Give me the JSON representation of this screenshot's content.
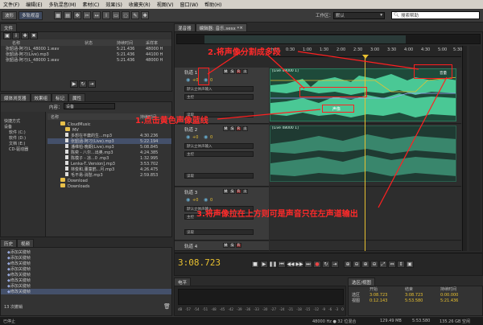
{
  "menu": [
    "文件(F)",
    "编辑(E)",
    "多轨混音(M)",
    "素材(C)",
    "效果(S)",
    "收藏夹(R)",
    "视图(V)",
    "窗口(W)",
    "帮助(H)"
  ],
  "toolbar": {
    "waveform_label": "波形",
    "multitrack_label": "多轨视音",
    "workspace_label": "工作区：",
    "workspace_value": "默认",
    "search_placeholder": "搜索帮助"
  },
  "files_panel": {
    "tab": "文件",
    "columns": [
      "名称",
      "状态",
      "持续时间",
      "采样率"
    ],
    "rows": [
      {
        "name": "张韶涵-阿刁(L_48000 1.wav",
        "duration": "5:21.436",
        "rate": "48000 H"
      },
      {
        "name": "张韶涵-阿刁(Live).mp3",
        "duration": "5:21.436",
        "rate": "44100 H"
      },
      {
        "name": "张韶涵-阿刁(L_48000 1.wav",
        "duration": "5:21.436",
        "rate": "48000 H"
      }
    ]
  },
  "media_panel": {
    "tabs": [
      "媒体浏览器",
      "效果组",
      "标记",
      "属性"
    ],
    "content_label": "内容：",
    "content_value": "设备",
    "left_items": [
      "快捷方式",
      "设备",
      "软件 (C:)",
      "软件 (D:)",
      "文档 (E:)",
      "CD-驱动器"
    ],
    "columns": [
      "名称",
      "持续时间"
    ],
    "tree": [
      {
        "name": "CloudMusic",
        "kind": "folder",
        "duration": ""
      },
      {
        "name": "MV",
        "kind": "folder",
        "duration": ""
      },
      {
        "name": "多想在平庸的生...mp3",
        "kind": "file",
        "duration": "4:30.236"
      },
      {
        "name": "张韶涵-阿刁(Live).mp3",
        "kind": "file",
        "duration": "5:22.194"
      },
      {
        "name": "潘维柏-晚期(Live).mp3",
        "kind": "file",
        "duration": "5:08.845"
      },
      {
        "name": "陈奕 - 八尔...出奥.mp3",
        "kind": "file",
        "duration": "4:24.385"
      },
      {
        "name": "陈模子 - 凉...0 .mp3",
        "kind": "file",
        "duration": "1:32.995"
      },
      {
        "name": "Lenka-T..Version].mp3",
        "kind": "file",
        "duration": "3:53.702"
      },
      {
        "name": "林俊和,董童鹤...月.mp3",
        "kind": "file",
        "duration": "4:26.475"
      },
      {
        "name": "毛不易-消愁.mp3",
        "kind": "file",
        "duration": "2:59.853"
      },
      {
        "name": "Download",
        "kind": "folder",
        "duration": ""
      },
      {
        "name": "Downloads",
        "kind": "folder",
        "duration": ""
      }
    ]
  },
  "history_panel": {
    "tabs": [
      "历史",
      "视频"
    ],
    "items": [
      "添加关键帧",
      "添加关键帧",
      "修改关键帧",
      "添加关键帧",
      "修改关键帧",
      "修改关键帧",
      "添加关键帧",
      "修改关键帧"
    ],
    "footer": "13 次撤销"
  },
  "editor": {
    "tabs": [
      "混音器",
      "编辑器: 音乐.sesx *"
    ],
    "ruler": [
      "hms",
      "0:30",
      "1:00",
      "1:30",
      "2:00",
      "2:30",
      "3:00",
      "3:30",
      "4:00",
      "4:30",
      "5:00",
      "5:30"
    ],
    "tracks": [
      {
        "name": "轨道 1",
        "volume": "+0",
        "pan": "0",
        "input": "默认立体声输入",
        "output": "主控",
        "mode": "读取",
        "clip": "[Live 48000 1]"
      },
      {
        "name": "轨道 2",
        "volume": "+0",
        "pan": "0",
        "input": "默认立体声输入",
        "output": "主控",
        "mode": "读取",
        "clip": "[Live 48000 1]"
      },
      {
        "name": "轨道 3",
        "volume": "+0",
        "pan": "0",
        "input": "默认立体声输入",
        "output": "主控",
        "mode": "读取",
        "clip": ""
      },
      {
        "name": "轨道 4",
        "volume": "+0",
        "pan": "0",
        "input": "",
        "output": "",
        "mode": "",
        "clip": ""
      }
    ],
    "clip_tag_pan": "声像",
    "clip_tag_vol": "音量",
    "time": "3:08.723"
  },
  "annotations": {
    "a1": "2.将声像分割成多段",
    "a2": "1.点击黄色声像蓝线",
    "a3": "3.将声像拉在上方则可是声音只在左声道输出"
  },
  "levels": {
    "tab": "电平",
    "scale": [
      "dB",
      "-57",
      "-54",
      "-51",
      "-48",
      "-45",
      "-42",
      "-39",
      "-36",
      "-33",
      "-30",
      "-27",
      "-24",
      "-21",
      "-18",
      "-15",
      "-12",
      "-9",
      "-6",
      "-3",
      "0"
    ]
  },
  "selection": {
    "tab": "选区/视图",
    "columns": [
      "开始",
      "结束",
      "持续时间"
    ],
    "rows": [
      {
        "label": "选区",
        "start": "3:08.723",
        "end": "3:08.723",
        "dur": "0:00.000"
      },
      {
        "label": "视图",
        "start": "0:12.143",
        "end": "5:53.580",
        "dur": "5:21.436"
      }
    ]
  },
  "status": {
    "left": "已停止",
    "rate": "48000 Hz ● 32 位混合",
    "mem": "129.49 MB",
    "dur": "5:53.580",
    "disk": "135.26 GB 空闲"
  },
  "colors": {
    "waveform": "#4fd6a0",
    "clip_bg": "#1e4a3a",
    "annotation": "#ff2a2a",
    "playhead": "#e8c030",
    "panline": "#9aa6ff"
  }
}
